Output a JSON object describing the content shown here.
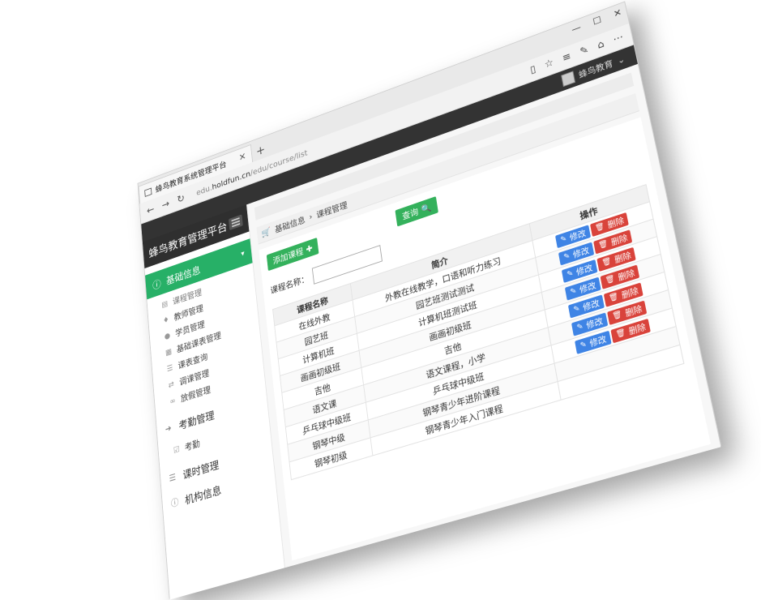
{
  "browser": {
    "tab_title": "蜂鸟教育系统管理平台",
    "tab_close": "×",
    "new_tab": "+",
    "url_prefix": "edu.",
    "url_domain": "holdfun.cn",
    "url_path": "/edu/course/list",
    "win_min": "—",
    "win_max": "☐",
    "win_close": "✕"
  },
  "header": {
    "user_name": "蜂鸟教育",
    "user_caret": "⌄"
  },
  "sidebar": {
    "brand": "蜂鸟教育管理平台",
    "groups": [
      {
        "label": "基础信息",
        "items": [
          "课程管理",
          "教师管理",
          "学员管理",
          "基础课表管理",
          "课表查询",
          "调课管理",
          "放假管理"
        ]
      }
    ],
    "attendance": {
      "label": "考勤管理",
      "items": [
        "考勤"
      ]
    },
    "hours": {
      "label": "课时管理"
    },
    "org": {
      "label": "机构信息"
    }
  },
  "breadcrumb": {
    "root": "基础信息",
    "sep": "›",
    "current": "课程管理"
  },
  "toolbar": {
    "add_label": "添加课程",
    "query_label": "查询"
  },
  "form": {
    "name_label": "课程名称：",
    "name_value": ""
  },
  "table": {
    "columns": [
      "课程名称",
      "简介",
      "操作"
    ],
    "rows": [
      [
        "在线外教",
        "外教在线教学，口语和听力练习"
      ],
      [
        "园艺班",
        "园艺班测试测试"
      ],
      [
        "计算机班",
        "计算机班测试班"
      ],
      [
        "画画初级班",
        "画画初级班"
      ],
      [
        "吉他",
        "吉他"
      ],
      [
        "语文课",
        "语文课程，小学"
      ],
      [
        "乒乓球中级班",
        "乒乓球中级班"
      ],
      [
        "钢琴中级",
        "钢琴青少年进阶课程"
      ],
      [
        "钢琴初级",
        "钢琴青少年入门课程"
      ]
    ],
    "edit_label": "修改",
    "delete_label": "删除"
  },
  "colors": {
    "green": "#27b067",
    "edit_blue": "#3f84e5",
    "delete_red": "#d9433b",
    "header_dark": "#333333"
  }
}
